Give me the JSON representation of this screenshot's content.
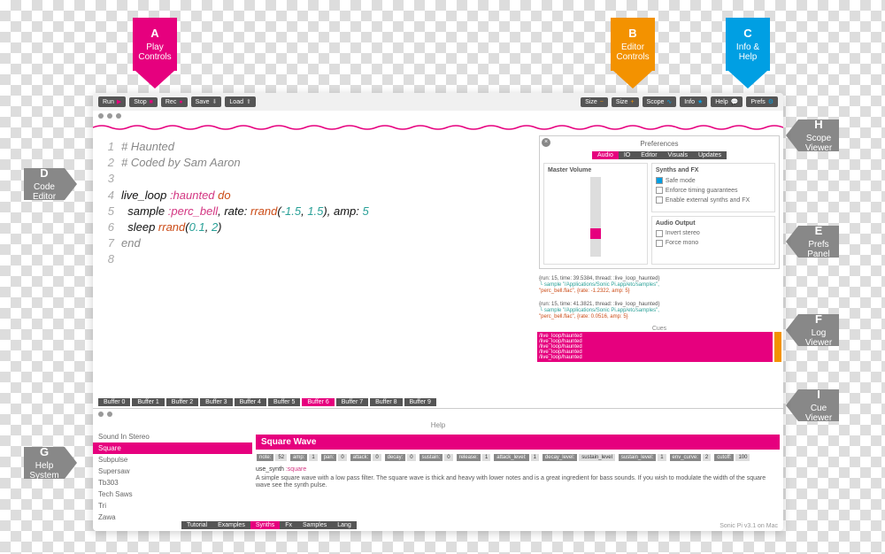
{
  "annotations": {
    "a": {
      "letter": "A",
      "label": "Play Controls"
    },
    "b": {
      "letter": "B",
      "label": "Editor Controls"
    },
    "c": {
      "letter": "C",
      "label": "Info & Help"
    },
    "d": {
      "letter": "D",
      "label": "Code Editor"
    },
    "e": {
      "letter": "E",
      "label": "Prefs Panel"
    },
    "f": {
      "letter": "F",
      "label": "Log Viewer"
    },
    "g": {
      "letter": "G",
      "label": "Help System"
    },
    "h": {
      "letter": "H",
      "label": "Scope Viewer"
    },
    "i": {
      "letter": "I",
      "label": "Cue Viewer"
    }
  },
  "toolbar": {
    "run": "Run",
    "stop": "Stop",
    "rec": "Rec",
    "save": "Save",
    "load": "Load",
    "size_minus": "Size",
    "size_plus": "Size",
    "scope": "Scope",
    "info": "Info",
    "help": "Help",
    "prefs": "Prefs"
  },
  "code": {
    "l1": "# Haunted",
    "l2": "# Coded by Sam Aaron",
    "l4a": "live_loop ",
    "l4b": ":haunted",
    "l4c": " do",
    "l5a": "  sample ",
    "l5b": ":perc_bell",
    "l5c": ", rate: ",
    "l5d": "rrand",
    "l5e": "(",
    "l5f": "-1.5",
    "l5g": ", ",
    "l5h": "1.5",
    "l5i": "), amp: ",
    "l5j": "5",
    "l6a": "  sleep ",
    "l6b": "rrand",
    "l6c": "(",
    "l6d": "0.1",
    "l6e": ", ",
    "l6f": "2",
    "l6g": ")",
    "l7": "end",
    "gutters": {
      "1": "1",
      "2": "2",
      "3": "3",
      "4": "4",
      "5": "5",
      "6": "6",
      "7": "7",
      "8": "8"
    }
  },
  "prefs": {
    "title": "Preferences",
    "tabs": {
      "audio": "Audio",
      "io": "IO",
      "editor": "Editor",
      "visuals": "Visuals",
      "updates": "Updates"
    },
    "master_volume": "Master Volume",
    "synths_fx": "Synths and FX",
    "safe_mode": "Safe mode",
    "timing": "Enforce timing guarantees",
    "external": "Enable external synths and FX",
    "audio_output": "Audio Output",
    "invert": "Invert stereo",
    "mono": "Force mono"
  },
  "log": {
    "r1": "{run: 15, time: 39.5384, thread: :live_loop_haunted}",
    "r1s": " └ sample \"/Applications/Sonic Pi.app/etc/samples\",",
    "r1p": "           \"perc_bell.flac\", {rate: -1.2322, amp: 5}",
    "r2": "{run: 15, time: 41.3821, thread: :live_loop_haunted}",
    "r2s": " └ sample \"/Applications/Sonic Pi.app/etc/samples\",",
    "r2p": "           \"perc_bell.flac\", {rate: 0.0516, amp: 5}"
  },
  "cues": {
    "title": "Cues",
    "items": [
      "/live_loop/haunted",
      "/live_loop/haunted",
      "/live_loop/haunted",
      "/live_loop/haunted",
      "/live_loop/haunted"
    ]
  },
  "buffers": [
    "Buffer 0",
    "Buffer 1",
    "Buffer 2",
    "Buffer 3",
    "Buffer 4",
    "Buffer 5",
    "Buffer 6",
    "Buffer 7",
    "Buffer 8",
    "Buffer 9"
  ],
  "buffer_active": 6,
  "help": {
    "title": "Help",
    "items": [
      "Sound In Stereo",
      "Square",
      "Subpulse",
      "Supersaw",
      "Tb303",
      "Tech Saws",
      "Tri",
      "Zawa"
    ],
    "selected": "Square",
    "heading": "Square Wave",
    "params": [
      {
        "k": "note:",
        "v": "52"
      },
      {
        "k": "amp:",
        "v": "1"
      },
      {
        "k": "pan:",
        "v": "0"
      },
      {
        "k": "attack:",
        "v": "0"
      },
      {
        "k": "decay:",
        "v": "0"
      },
      {
        "k": "sustain:",
        "v": "0"
      },
      {
        "k": "release:",
        "v": "1"
      },
      {
        "k": "attack_level:",
        "v": "1"
      },
      {
        "k": "decay_level:",
        "v": "sustain_level"
      },
      {
        "k": "sustain_level:",
        "v": "1"
      },
      {
        "k": "env_curve:",
        "v": "2"
      },
      {
        "k": "cutoff:",
        "v": "100"
      }
    ],
    "use_a": "use_synth ",
    "use_b": ":square",
    "desc": "A simple square wave with a low pass filter. The square wave is thick and heavy with lower notes and is a great ingredient for bass sounds. If you wish to modulate the width of the square wave see the synth pulse.",
    "tabs": [
      "Tutorial",
      "Examples",
      "Synths",
      "Fx",
      "Samples",
      "Lang"
    ],
    "tab_active": 2
  },
  "footer": "Sonic Pi v3.1 on Mac"
}
